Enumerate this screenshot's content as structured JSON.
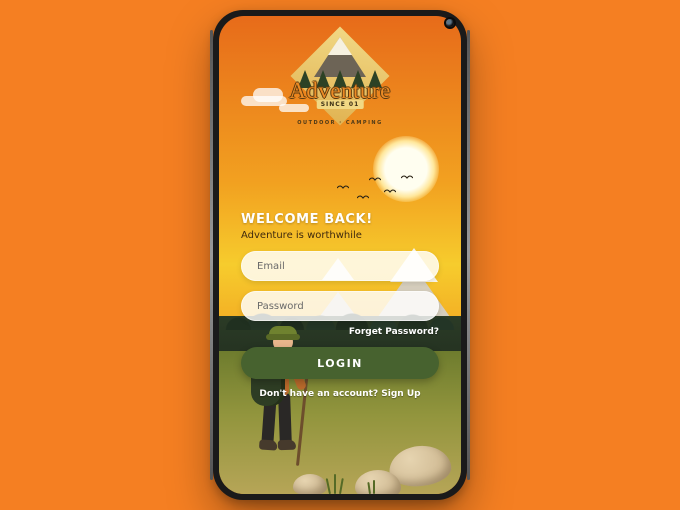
{
  "logo": {
    "brand": "Adventure",
    "since_label": "SINCE",
    "since_year": "01",
    "subline": "OUTDOOR · CAMPING"
  },
  "heading": "WELCOME BACK!",
  "tagline": "Adventure is worthwhile",
  "fields": {
    "email": {
      "placeholder": "Email",
      "value": ""
    },
    "password": {
      "placeholder": "Password",
      "value": ""
    }
  },
  "forgot_label": "Forget Password?",
  "login_label": "LOGIN",
  "signup_prompt": "Don't have an account? Sign Up",
  "colors": {
    "page_bg": "#f57f22",
    "primary_button": "#47622f"
  }
}
